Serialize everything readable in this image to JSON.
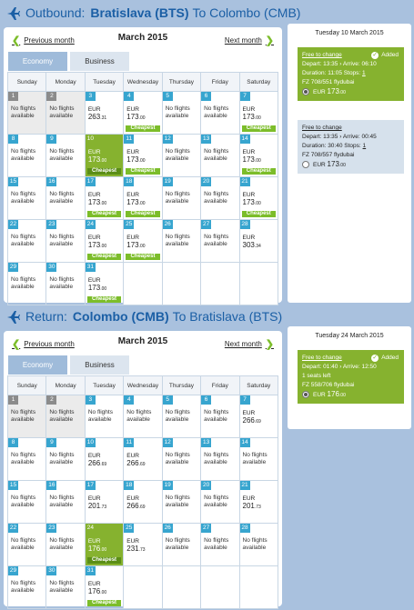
{
  "outbound": {
    "label": "Outbound:",
    "from": "Bratislava (BTS)",
    "to": "To Colombo (CMB)",
    "prev": "Previous month",
    "next": "Next month",
    "month": "March 2015",
    "tabs": [
      "Economy",
      "Business"
    ],
    "weekdays": [
      "Sunday",
      "Monday",
      "Tuesday",
      "Wednesday",
      "Thursday",
      "Friday",
      "Saturday"
    ],
    "weeks": [
      [
        {
          "d": "1",
          "t": "past",
          "nf": true
        },
        {
          "d": "2",
          "t": "past",
          "nf": true
        },
        {
          "d": "3",
          "cur": "EUR",
          "amt": "263",
          "dec": ".31"
        },
        {
          "d": "4",
          "cur": "EUR",
          "amt": "173",
          "dec": ".00",
          "cheap": "Cheapest"
        },
        {
          "d": "5",
          "nf": true
        },
        {
          "d": "6",
          "nf": true
        },
        {
          "d": "7",
          "cur": "EUR",
          "amt": "173",
          "dec": ".00",
          "cheap": "Cheapest"
        }
      ],
      [
        {
          "d": "8",
          "nf": true
        },
        {
          "d": "9",
          "nf": true
        },
        {
          "d": "10",
          "t": "selected",
          "cur": "EUR",
          "amt": "173",
          "dec": ".00",
          "cheap": "Cheapest"
        },
        {
          "d": "11",
          "cur": "EUR",
          "amt": "173",
          "dec": ".00",
          "cheap": "Cheapest"
        },
        {
          "d": "12",
          "nf": true
        },
        {
          "d": "13",
          "nf": true
        },
        {
          "d": "14",
          "cur": "EUR",
          "amt": "173",
          "dec": ".00",
          "cheap": "Cheapest"
        }
      ],
      [
        {
          "d": "15",
          "nf": true
        },
        {
          "d": "16",
          "nf": true
        },
        {
          "d": "17",
          "cur": "EUR",
          "amt": "173",
          "dec": ".00",
          "cheap": "Cheapest"
        },
        {
          "d": "18",
          "cur": "EUR",
          "amt": "173",
          "dec": ".00",
          "cheap": "Cheapest"
        },
        {
          "d": "19",
          "nf": true
        },
        {
          "d": "20",
          "nf": true
        },
        {
          "d": "21",
          "cur": "EUR",
          "amt": "173",
          "dec": ".00",
          "cheap": "Cheapest"
        }
      ],
      [
        {
          "d": "22",
          "nf": true
        },
        {
          "d": "23",
          "nf": true
        },
        {
          "d": "24",
          "cur": "EUR",
          "amt": "173",
          "dec": ".00",
          "cheap": "Cheapest"
        },
        {
          "d": "25",
          "cur": "EUR",
          "amt": "173",
          "dec": ".00",
          "cheap": "Cheapest"
        },
        {
          "d": "26",
          "nf": true
        },
        {
          "d": "27",
          "nf": true
        },
        {
          "d": "28",
          "cur": "EUR",
          "amt": "303",
          "dec": ".34"
        }
      ],
      [
        {
          "d": "29",
          "nf": true
        },
        {
          "d": "30",
          "nf": true
        },
        {
          "d": "31",
          "cur": "EUR",
          "amt": "173",
          "dec": ".00",
          "cheap": "Cheapest"
        },
        {
          "t": "empty"
        },
        {
          "t": "empty"
        },
        {
          "t": "empty"
        },
        {
          "t": "empty"
        }
      ]
    ],
    "summary": {
      "date": "Tuesday 10 March 2015",
      "options": [
        {
          "style": "green",
          "free": "Free to change",
          "added": "Added",
          "depart_label": "Depart:",
          "depart": "13:35",
          "arrive_label": "Arrive:",
          "arrive": "06:10",
          "duration_label": "Duration:",
          "duration": "11:05",
          "stops_label": "Stops:",
          "stops": "1",
          "flight": "FZ 708/551 flydubai",
          "cur": "EUR",
          "amt": "173",
          "dec": ".00",
          "selected": true
        },
        {
          "style": "gray",
          "free": "Free to change",
          "depart_label": "Depart:",
          "depart": "13:35",
          "arrive_label": "Arrive:",
          "arrive": "00:45",
          "duration_label": "Duration:",
          "duration": "30:40",
          "stops_label": "Stops:",
          "stops": "1",
          "flight": "FZ 708/557 flydubai",
          "cur": "EUR",
          "amt": "173",
          "dec": ".00",
          "selected": false
        }
      ]
    }
  },
  "return": {
    "label": "Return:",
    "from": "Colombo (CMB)",
    "to": "To Bratislava (BTS)",
    "prev": "Previous month",
    "next": "Next month",
    "month": "March 2015",
    "tabs": [
      "Economy",
      "Business"
    ],
    "weekdays": [
      "Sunday",
      "Monday",
      "Tuesday",
      "Wednesday",
      "Thursday",
      "Friday",
      "Saturday"
    ],
    "weeks": [
      [
        {
          "d": "1",
          "t": "past",
          "nf": true
        },
        {
          "d": "2",
          "t": "past",
          "nf": true
        },
        {
          "d": "3",
          "nf": true
        },
        {
          "d": "4",
          "nf": true
        },
        {
          "d": "5",
          "nf": true
        },
        {
          "d": "6",
          "nf": true
        },
        {
          "d": "7",
          "cur": "EUR",
          "amt": "266",
          "dec": ".69"
        }
      ],
      [
        {
          "d": "8",
          "nf": true
        },
        {
          "d": "9",
          "nf": true
        },
        {
          "d": "10",
          "cur": "EUR",
          "amt": "266",
          "dec": ".69"
        },
        {
          "d": "11",
          "cur": "EUR",
          "amt": "266",
          "dec": ".69"
        },
        {
          "d": "12",
          "nf": true
        },
        {
          "d": "13",
          "nf": true
        },
        {
          "d": "14",
          "nf": true
        }
      ],
      [
        {
          "d": "15",
          "nf": true
        },
        {
          "d": "16",
          "nf": true
        },
        {
          "d": "17",
          "cur": "EUR",
          "amt": "201",
          "dec": ".73"
        },
        {
          "d": "18",
          "cur": "EUR",
          "amt": "266",
          "dec": ".69"
        },
        {
          "d": "19",
          "nf": true
        },
        {
          "d": "20",
          "nf": true
        },
        {
          "d": "21",
          "cur": "EUR",
          "amt": "201",
          "dec": ".73"
        }
      ],
      [
        {
          "d": "22",
          "nf": true
        },
        {
          "d": "23",
          "nf": true
        },
        {
          "d": "24",
          "t": "selected",
          "cur": "EUR",
          "amt": "176",
          "dec": ".00",
          "cheap": "Cheapest"
        },
        {
          "d": "25",
          "cur": "EUR",
          "amt": "231",
          "dec": ".73"
        },
        {
          "d": "26",
          "nf": true
        },
        {
          "d": "27",
          "nf": true
        },
        {
          "d": "28",
          "nf": true
        }
      ],
      [
        {
          "d": "29",
          "nf": true
        },
        {
          "d": "30",
          "nf": true
        },
        {
          "d": "31",
          "cur": "EUR",
          "amt": "176",
          "dec": ".00",
          "cheap": "Cheapest"
        },
        {
          "t": "empty"
        },
        {
          "t": "empty"
        },
        {
          "t": "empty"
        },
        {
          "t": "empty"
        }
      ]
    ],
    "summary": {
      "date": "Tuesday 24 March 2015",
      "options": [
        {
          "style": "green",
          "free": "Free to change",
          "added": "Added",
          "depart_label": "Depart:",
          "depart": "01:40",
          "arrive_label": "Arrive:",
          "arrive": "12:50",
          "seats": "1 seats left",
          "flight": "FZ 558/706 flydubai",
          "cur": "EUR",
          "amt": "176",
          "dec": ".00",
          "selected": true
        }
      ]
    }
  },
  "no_flights": [
    "No flights",
    "available"
  ]
}
